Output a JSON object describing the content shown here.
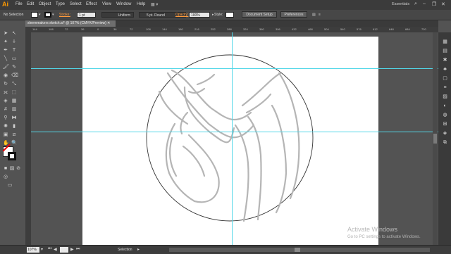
{
  "menubar": {
    "logo": "Ai",
    "items": [
      "File",
      "Edit",
      "Object",
      "Type",
      "Select",
      "Effect",
      "View",
      "Window",
      "Help"
    ],
    "workspace": "Essentials"
  },
  "control": {
    "selection_label": "No Selection",
    "stroke_label": "Stroke:",
    "stroke_weight": "1 pt",
    "profile": "Uniform",
    "brush": "5 pt. Round",
    "opacity_label": "Opacity:",
    "opacity_value": "100%",
    "style_label": "Style:",
    "doc_setup": "Document Setup",
    "preferences": "Preferences"
  },
  "document": {
    "tab_title": "sleemmakers sketch.ai* @ 107% (CMYK/Preview)"
  },
  "ruler": {
    "ticks": [
      "144",
      "108",
      "72",
      "36",
      "0",
      "36",
      "72",
      "108",
      "144",
      "180",
      "216",
      "252",
      "288",
      "324",
      "360",
      "396",
      "432",
      "468",
      "504",
      "540",
      "576",
      "612",
      "648",
      "684",
      "720",
      "756"
    ]
  },
  "status": {
    "zoom": "107%",
    "tool": "Selection"
  },
  "watermark": {
    "title": "Activate Windows",
    "subtitle": "Go to PC settings to activate Windows."
  },
  "colors": {
    "guide": "#52d7e8",
    "accent": "#ff9a00"
  }
}
